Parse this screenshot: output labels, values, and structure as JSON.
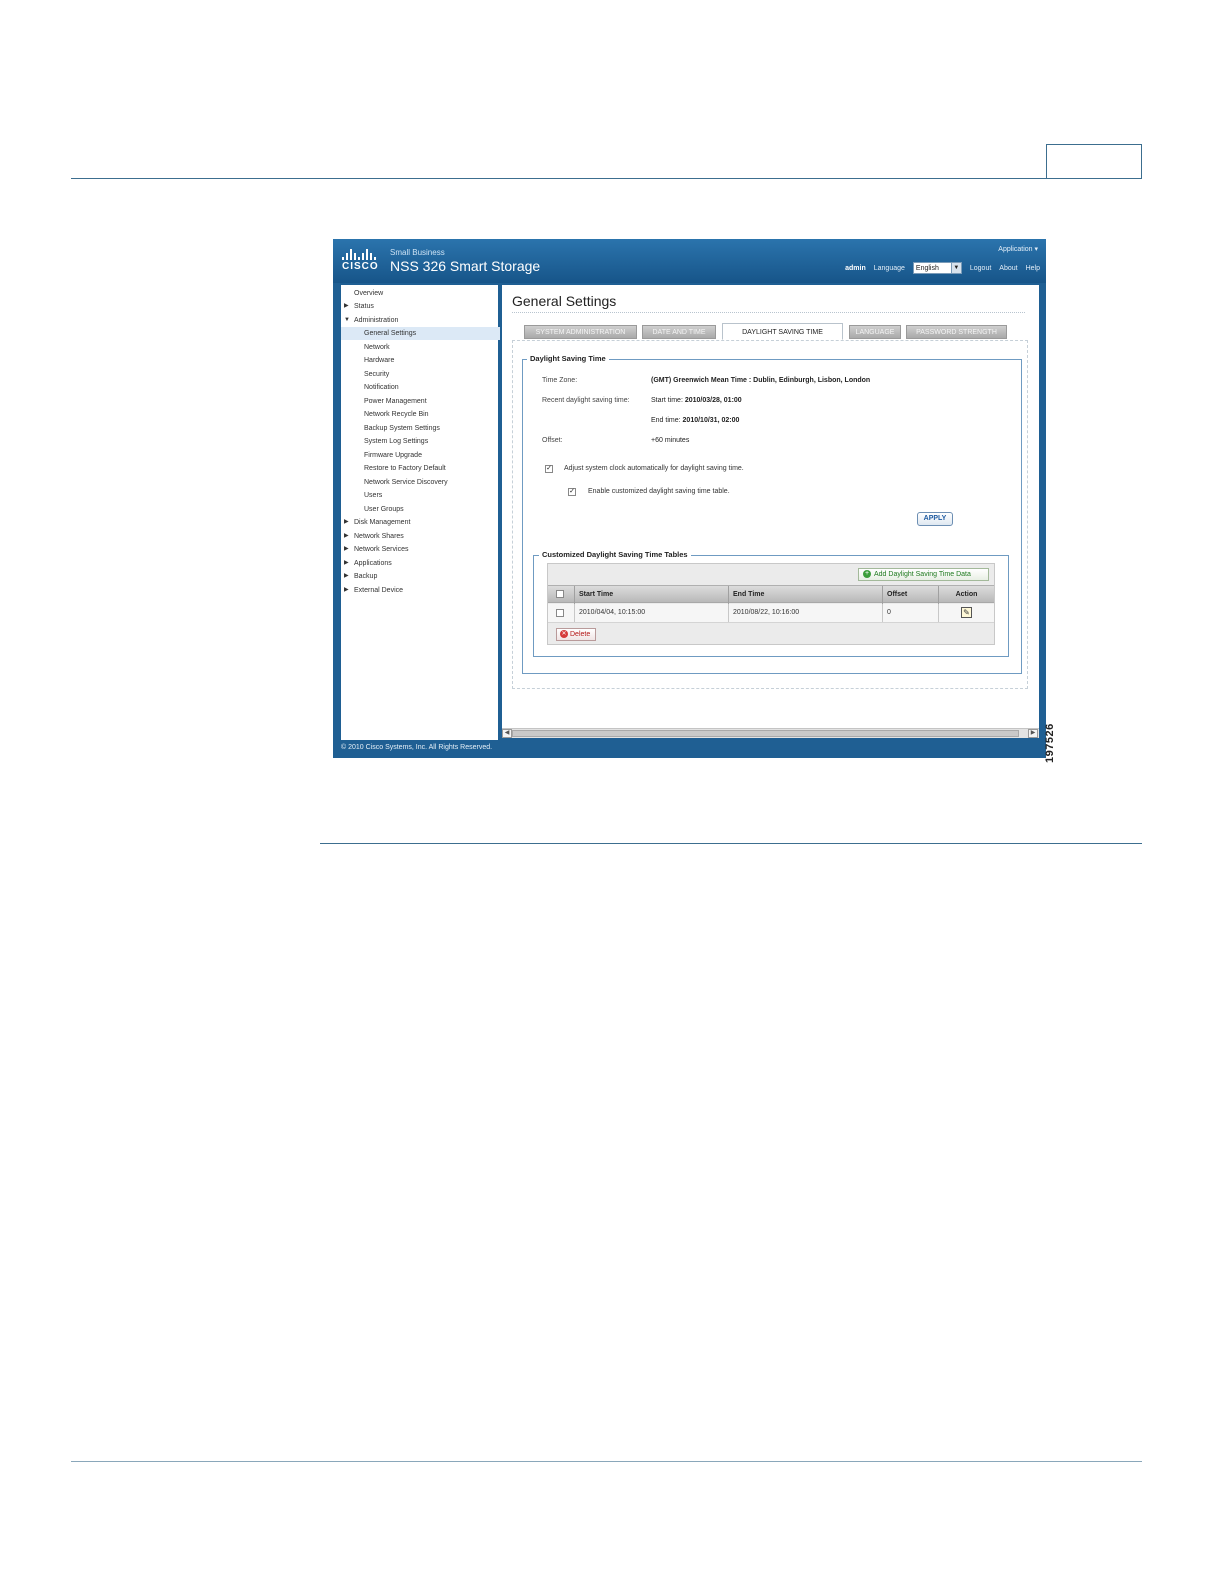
{
  "figure_id": "197526",
  "banner": {
    "logo_text": "CISCO",
    "small_business": "Small Business",
    "product_name": "NSS 326 Smart Storage",
    "app_menu": "Application ▾",
    "user": "admin",
    "language_label": "Language",
    "language_value": "English",
    "logout": "Logout",
    "about": "About",
    "help": "Help"
  },
  "nav": {
    "items": [
      {
        "label": "Overview"
      },
      {
        "label": "Status"
      },
      {
        "label": "Administration"
      },
      {
        "label": "General Settings"
      },
      {
        "label": "Network"
      },
      {
        "label": "Hardware"
      },
      {
        "label": "Security"
      },
      {
        "label": "Notification"
      },
      {
        "label": "Power Management"
      },
      {
        "label": "Network Recycle Bin"
      },
      {
        "label": "Backup System Settings"
      },
      {
        "label": "System Log Settings"
      },
      {
        "label": "Firmware Upgrade"
      },
      {
        "label": "Restore to Factory Default"
      },
      {
        "label": "Network Service Discovery"
      },
      {
        "label": "Users"
      },
      {
        "label": "User Groups"
      },
      {
        "label": "Disk Management"
      },
      {
        "label": "Network Shares"
      },
      {
        "label": "Network Services"
      },
      {
        "label": "Applications"
      },
      {
        "label": "Backup"
      },
      {
        "label": "External Device"
      }
    ]
  },
  "main": {
    "title": "General Settings",
    "tabs": [
      {
        "label": "SYSTEM ADMINISTRATION"
      },
      {
        "label": "DATE AND TIME"
      },
      {
        "label": "DAYLIGHT SAVING TIME"
      },
      {
        "label": "LANGUAGE"
      },
      {
        "label": "PASSWORD STRENGTH"
      }
    ],
    "dst": {
      "legend": "Daylight Saving Time",
      "time_zone_label": "Time Zone:",
      "time_zone_value": "(GMT) Greenwich Mean Time : Dublin, Edinburgh, Lisbon, London",
      "recent_label": "Recent daylight saving time:",
      "start_label": "Start time:",
      "start_value": "2010/03/28, 01:00",
      "end_label": "End time:",
      "end_value": "2010/10/31, 02:00",
      "offset_label": "Offset:",
      "offset_value": "+60 minutes",
      "adjust_label": "Adjust system clock automatically for daylight saving time.",
      "adjust_checked": true,
      "custom_label": "Enable customized daylight saving time table.",
      "custom_checked": true,
      "apply": "APPLY"
    },
    "custom_table": {
      "legend": "Customized Daylight Saving Time Tables",
      "add_button": "Add Daylight Saving Time Data",
      "columns": [
        "Start Time",
        "End Time",
        "Offset",
        "Action"
      ],
      "rows": [
        {
          "start": "2010/04/04, 10:15:00",
          "end": "2010/08/22, 10:16:00",
          "offset": "0"
        }
      ],
      "delete_button": "Delete"
    }
  },
  "footer": "© 2010 Cisco Systems, Inc. All Rights Reserved."
}
